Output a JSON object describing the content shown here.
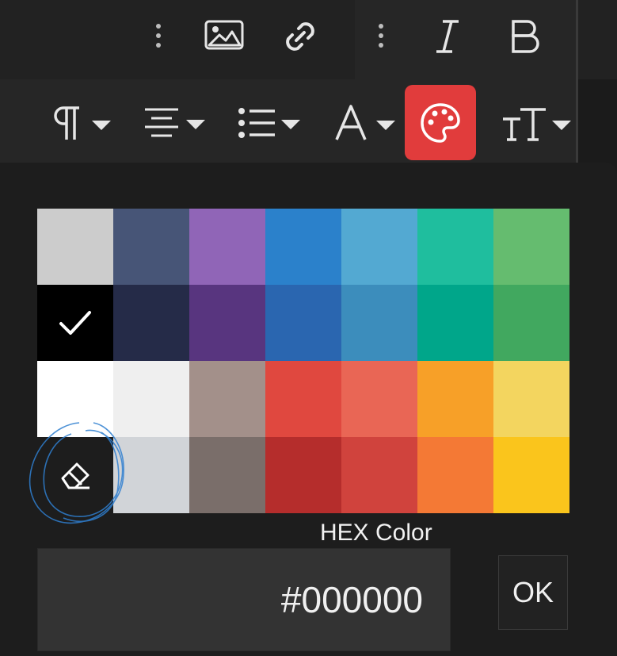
{
  "toolbar": {
    "top": [
      {
        "name": "more-icon"
      },
      {
        "name": "image-icon"
      },
      {
        "name": "link-icon"
      },
      {
        "name": "more-icon"
      },
      {
        "name": "italic-icon"
      },
      {
        "name": "bold-icon"
      }
    ],
    "bottom": [
      {
        "name": "paragraph-icon"
      },
      {
        "name": "align-icon"
      },
      {
        "name": "list-icon"
      },
      {
        "name": "font-color-icon"
      },
      {
        "name": "palette-icon",
        "active": true
      },
      {
        "name": "text-size-icon"
      }
    ],
    "active_color": "#e13c3c"
  },
  "palette": {
    "swatches": [
      "#cccccc",
      "#475577",
      "#9065b7",
      "#2b81cb",
      "#53a9d2",
      "#1fbe9e",
      "#65bc6f",
      "#000000",
      "#252b48",
      "#58357f",
      "#2a66b0",
      "#3c8dbc",
      "#00a68a",
      "#41a85f",
      "#ffffff",
      "#efefef",
      "#a3908a",
      "#e0483f",
      "#e96655",
      "#f7a028",
      "#f3d55f",
      "eraser",
      "#d1d4d8",
      "#7a6e6a",
      "#b52d2c",
      "#d0433d",
      "#f47935",
      "#fac51c"
    ],
    "selected_index": 7,
    "eraser_icon": "eraser-icon",
    "check_icon": "check-icon"
  },
  "hex": {
    "label": "HEX Color",
    "value": "#000000",
    "ok_label": "OK"
  }
}
